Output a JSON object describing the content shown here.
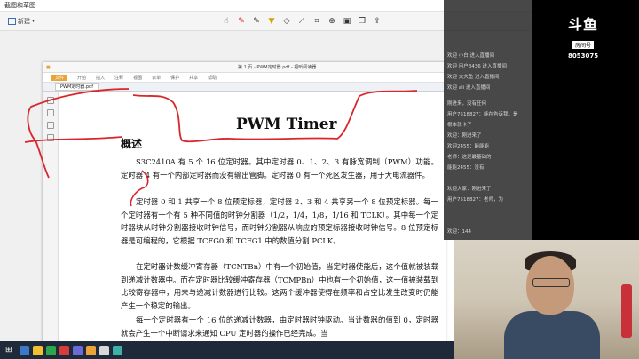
{
  "snip": {
    "title": "截图和草图",
    "new_label": "新建"
  },
  "pdf": {
    "menu": [
      "文件",
      "开始",
      "插入",
      "注释",
      "视图",
      "表单",
      "保护",
      "共享",
      "帮助"
    ],
    "tab_label": "PWM定时器.pdf",
    "window_title": "第 1 页 - PWM定时器.pdf - 福昕阅读器"
  },
  "doc": {
    "title": "PWM Timer",
    "heading": "概述",
    "p1": "S3C2410A 有 5 个 16 位定时器。其中定时器 0、1、2、3 有脉宽调制（PWM）功能。定时器 4 有一个内部定时器而没有输出管脚。定时器 0 有一个死区发生器，用于大电流器件。",
    "p2": "定时器 0 和 1 共享一个 8 位预定标器，定时器 2、3 和 4 共享另一个 8 位预定标器。每一个定时器有一个有 5 种不同值的时钟分割器（1/2，1/4，1/8，1/16 和 TCLK）。其中每一个定时器块从时钟分割器接收时钟信号，而时钟分割器从响应的预定标器接收时钟信号。8 位预定标器是可编程的，它根据 TCFG0 和 TCFG1 中的数值分割 PCLK。",
    "p3": "在定时器计数缓冲寄存器（TCNTBn）中有一个初始值，当定时器使能后，这个值就被装载到递减计数器中。而在定时器比较缓冲寄存器（TCMPBn）中也有一个初始值，这一值被装载到比较寄存器中，用来与递减计数器进行比较。这两个缓冲器使得在频率和占空比发生改变时仍能产生一个稳定的输出。",
    "p4": "每一个定时器有一个 16 位的递减计数器，由定时器时钟驱动。当计数器的值到 0，定时器就会产生一个中断请求来通知 CPU 定时器的操作已经完成。当"
  },
  "chat": [
    "欢迎 小白 进入直播间",
    "欢迎 用户8436 进入直播间",
    "欢迎 大大鱼 进入直播间",
    "欢迎 ali 进入直播间",
    "刚进来，没有任何",
    "用户7518827：能在告诉我，是",
    "根本就卡了",
    "欢迎：刚进来了",
    "欢迎2455：能能能",
    "老师：这是最基础的",
    "能能2455：没有",
    "欢迎大家：刚进来了",
    "用户7518827：老师，为",
    "欢迎：144"
  ],
  "logo": {
    "brand": "斗鱼",
    "sub": "房间号",
    "room": "8053075"
  },
  "colors": {
    "annotation": "#d8262c",
    "accent": "#e8a33b"
  }
}
